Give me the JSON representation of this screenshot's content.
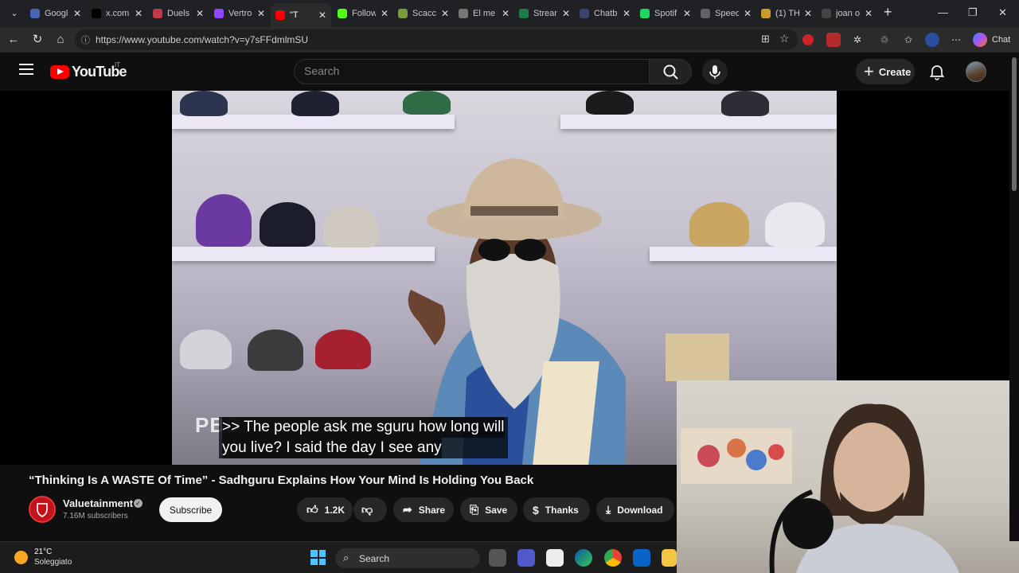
{
  "browser": {
    "tabs": [
      {
        "title": "Googl",
        "color": "#4a63b5"
      },
      {
        "title": "x.com",
        "color": "#000000"
      },
      {
        "title": "Duels",
        "color": "#c0394a"
      },
      {
        "title": "Vertro",
        "color": "#9146ff"
      },
      {
        "title": "\"T",
        "color": "#ff0000",
        "active": true
      },
      {
        "title": "Follow",
        "color": "#53fc18"
      },
      {
        "title": "Scacc",
        "color": "#7a9b3a"
      },
      {
        "title": "El me",
        "color": "#777777"
      },
      {
        "title": "Stream",
        "color": "#1f7a4a"
      },
      {
        "title": "Chatb",
        "color": "#3b4470"
      },
      {
        "title": "Spotif",
        "color": "#1ed760"
      },
      {
        "title": "Speed",
        "color": "#5f6368"
      },
      {
        "title": "(1) TH",
        "color": "#c89b2a"
      },
      {
        "title": "joan o",
        "color": "#444444"
      }
    ],
    "close_glyph": "✕",
    "new_tab_glyph": "+",
    "url": "https://www.youtube.com/watch?v=y7sFFdmlmSU",
    "chat_label": "Chat"
  },
  "youtube": {
    "logo_text": "YouTube",
    "region": "IT",
    "search_placeholder": "Search",
    "create_label": "Create"
  },
  "video": {
    "caption_line1": ">> The people ask me sguru how long will",
    "caption_line2": "you live? I said the day I see any",
    "watermark": "PBD",
    "title": "“Thinking Is A WASTE Of Time” - Sadhguru Explains How Your Mind Is Holding You Back",
    "channel": "Valuetainment",
    "subscribers": "7.16M subscribers",
    "subscribe_label": "Subscribe",
    "likes": "1.2K",
    "share_label": "Share",
    "save_label": "Save",
    "thanks_label": "Thanks",
    "download_label": "Download"
  },
  "taskbar": {
    "temperature": "21°C",
    "weather": "Soleggiato",
    "search_label": "Search"
  }
}
